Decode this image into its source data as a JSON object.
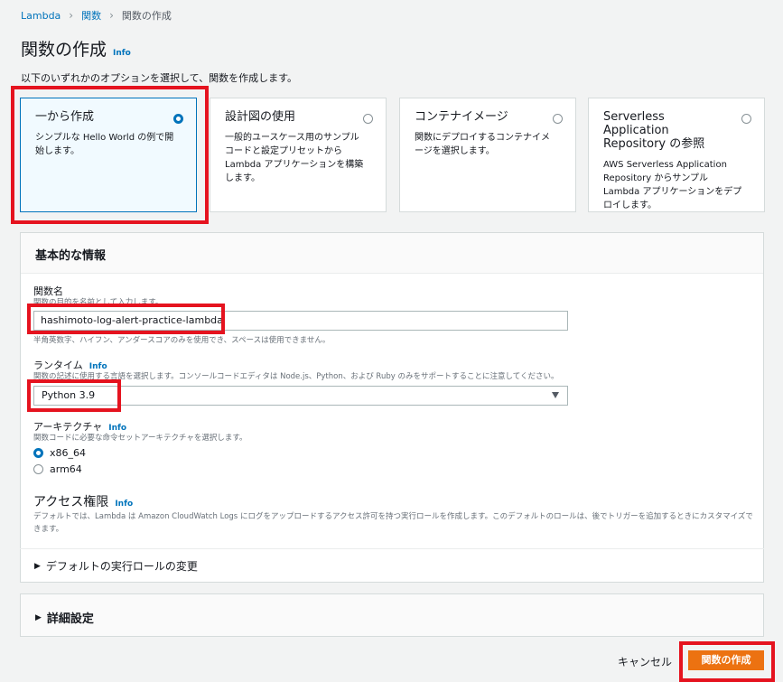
{
  "breadcrumb": {
    "items": [
      "Lambda",
      "関数",
      "関数の作成"
    ]
  },
  "page": {
    "title": "関数の作成",
    "info": "Info",
    "subtitle": "以下のいずれかのオプションを選択して、関数を作成します。"
  },
  "options": [
    {
      "title": "一から作成",
      "description": "シンプルな Hello World の例で開始します。",
      "selected": true
    },
    {
      "title": "設計図の使用",
      "description": "一般的ユースケース用のサンプルコードと設定プリセットから Lambda アプリケーションを構築します。",
      "selected": false
    },
    {
      "title": "コンテナイメージ",
      "description": "関数にデプロイするコンテナイメージを選択します。",
      "selected": false
    },
    {
      "title": "Serverless Application Repository の参照",
      "description": "AWS Serverless Application Repository からサンプル Lambda アプリケーションをデプロイします。",
      "selected": false
    }
  ],
  "basic_info": {
    "header": "基本的な情報",
    "function_name": {
      "label": "関数名",
      "description": "関数の目的を名前として入力します。",
      "value": "hashimoto-log-alert-practice-lambda",
      "hint": "半角英数字、ハイフン、アンダースコアのみを使用でき、スペースは使用できません。"
    },
    "runtime": {
      "label": "ランタイム",
      "info": "Info",
      "description": "関数の記述に使用する言語を選択します。コンソールコードエディタは Node.js、Python、および Ruby のみをサポートすることに注意してください。",
      "value": "Python 3.9"
    },
    "architecture": {
      "label": "アーキテクチャ",
      "info": "Info",
      "description": "関数コードに必要な命令セットアーキテクチャを選択します。",
      "options": [
        {
          "label": "x86_64",
          "selected": true
        },
        {
          "label": "arm64",
          "selected": false
        }
      ]
    },
    "permissions": {
      "label": "アクセス権限",
      "info": "Info",
      "description": "デフォルトでは、Lambda は Amazon CloudWatch Logs にログをアップロードするアクセス許可を持つ実行ロールを作成します。このデフォルトのロールは、後でトリガーを追加するときにカスタマイズできます。"
    },
    "change_role": "デフォルトの実行ロールの変更"
  },
  "advanced": {
    "label": "詳細設定"
  },
  "footer": {
    "cancel": "キャンセル",
    "create": "関数の作成"
  },
  "colors": {
    "primary": "#ec7211",
    "link": "#0073bb",
    "highlight": "#e5131f"
  }
}
